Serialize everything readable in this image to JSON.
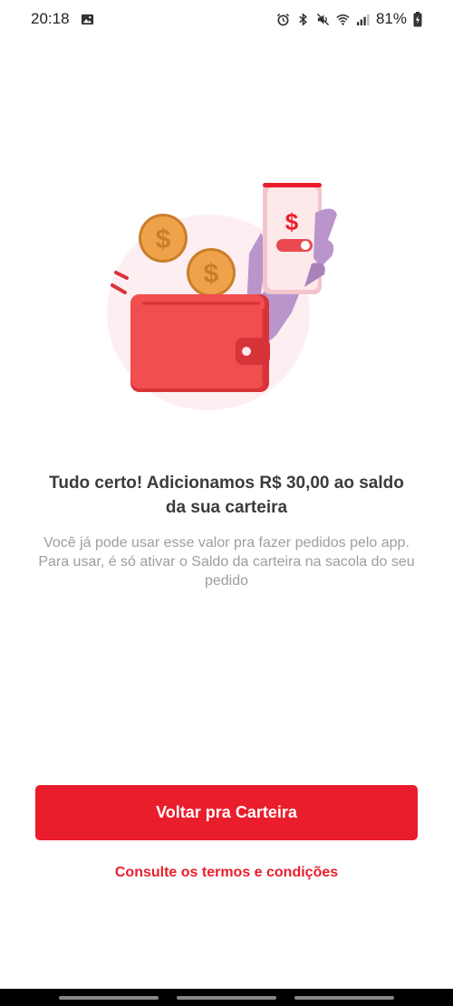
{
  "status_bar": {
    "time": "20:18",
    "battery": "81%",
    "icons": [
      "image-icon",
      "alarm-icon",
      "bluetooth-icon",
      "mute-icon",
      "wifi-icon",
      "signal-icon",
      "battery-icon"
    ]
  },
  "illustration": {
    "name": "wallet-coins-phone-illustration",
    "coin_symbol": "$",
    "phone_symbol": "$",
    "colors": {
      "wallet": "#f04e4f",
      "wallet_dark": "#d9333a",
      "coin": "#f0a24a",
      "coin_dark": "#c97e2b",
      "hand": "#b995cc",
      "background_blob": "#fbecef",
      "phone_screen": "#fde8ea"
    }
  },
  "message": {
    "title": "Tudo certo! Adicionamos R$ 30,00 ao saldo da sua carteira",
    "body": "Você já pode usar esse valor pra fazer pedidos pelo app. Para usar, é só ativar o Saldo da carteira na sacola do seu pedido"
  },
  "actions": {
    "primary_label": "Voltar pra Carteira",
    "terms_label": "Consulte os termos e condições"
  },
  "colors": {
    "accent": "#ea1d2c",
    "title_text": "#3b3b3b",
    "body_text": "#9e9e9e"
  }
}
